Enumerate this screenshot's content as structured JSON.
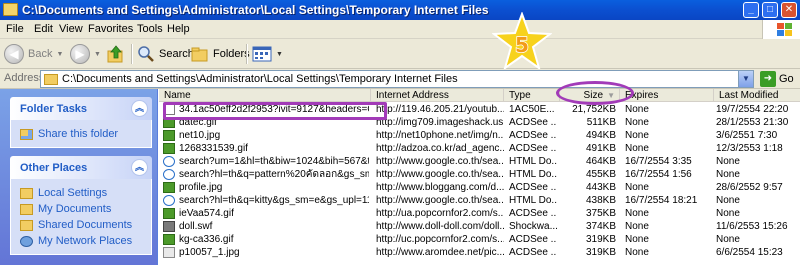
{
  "window": {
    "title": "C:\\Documents and Settings\\Administrator\\Local Settings\\Temporary Internet Files",
    "minimize_glyph": "_",
    "maximize_glyph": "□",
    "close_glyph": "✕"
  },
  "menu": [
    "File",
    "Edit",
    "View",
    "Favorites",
    "Tools",
    "Help"
  ],
  "toolbar": {
    "back_label": "Back",
    "search_label": "Search",
    "folders_label": "Folders"
  },
  "address": {
    "label": "Address",
    "value": "C:\\Documents and Settings\\Administrator\\Local Settings\\Temporary Internet Files",
    "go_label": "Go"
  },
  "task_pane": {
    "folder_tasks": {
      "title": "Folder Tasks",
      "items": [
        "Share this folder"
      ]
    },
    "other_places": {
      "title": "Other Places",
      "items": [
        "Local Settings",
        "My Documents",
        "Shared Documents",
        "My Network Places"
      ]
    }
  },
  "columns": {
    "name": "Name",
    "address": "Internet Address",
    "type": "Type",
    "size": "Size",
    "expires": "Expires",
    "modified": "Last Modified"
  },
  "files": [
    {
      "icon": "generic-file-icon",
      "name": "34.1ac50eff2d2f2953?ivit=9127&headers=Coo...",
      "address": "http://119.46.205.21/youtub...",
      "type": "1AC50E...",
      "size": "21,752KB",
      "expires": "None",
      "modified": "19/7/2554 22:20"
    },
    {
      "icon": "gif-file-icon",
      "name": "datec.gif",
      "address": "http://img709.imageshack.us...",
      "type": "ACDSee ...",
      "size": "511KB",
      "expires": "None",
      "modified": "28/1/2553 21:30"
    },
    {
      "icon": "gif-file-icon",
      "name": "net10.jpg",
      "address": "http://net10phone.net/img/n...",
      "type": "ACDSee ...",
      "size": "494KB",
      "expires": "None",
      "modified": "3/6/2551 7:30"
    },
    {
      "icon": "gif-file-icon",
      "name": "1268331539.gif",
      "address": "http://adzoa.co.kr/ad_agenc...",
      "type": "ACDSee ...",
      "size": "491KB",
      "expires": "None",
      "modified": "12/3/2553 1:18"
    },
    {
      "icon": "html-file-icon",
      "name": "search?um=1&hl=th&biw=1024&bih=567&tbm...",
      "address": "http://www.google.co.th/sea...",
      "type": "HTML Do...",
      "size": "464KB",
      "expires": "16/7/2554 3:35",
      "modified": "None"
    },
    {
      "icon": "html-file-icon",
      "name": "search?hl=th&q=pattern%20คัดลอก&gs_sm=e&g...",
      "address": "http://www.google.co.th/sea...",
      "type": "HTML Do...",
      "size": "455KB",
      "expires": "16/7/2554 1:56",
      "modified": "None"
    },
    {
      "icon": "gif-file-icon",
      "name": "profile.jpg",
      "address": "http://www.bloggang.com/d...",
      "type": "ACDSee ...",
      "size": "443KB",
      "expires": "None",
      "modified": "28/6/2552 9:57"
    },
    {
      "icon": "html-file-icon",
      "name": "search?hl=th&q=kitty&gs_sm=e&gs_upl=1187l...",
      "address": "http://www.google.co.th/sea...",
      "type": "HTML Do...",
      "size": "438KB",
      "expires": "16/7/2554 18:21",
      "modified": "None"
    },
    {
      "icon": "gif-file-icon",
      "name": "ieVaa574.gif",
      "address": "http://ua.popcornfor2.com/s...",
      "type": "ACDSee ...",
      "size": "375KB",
      "expires": "None",
      "modified": "None"
    },
    {
      "icon": "swf-file-icon",
      "name": "doll.swf",
      "address": "http://www.doll-doll.com/doll...",
      "type": "Shockwa...",
      "size": "374KB",
      "expires": "None",
      "modified": "11/6/2553 15:26"
    },
    {
      "icon": "gif-file-icon",
      "name": "kg-ca336.gif",
      "address": "http://uc.popcornfor2.com/s...",
      "type": "ACDSee ...",
      "size": "319KB",
      "expires": "None",
      "modified": "None"
    },
    {
      "icon": "jpg-file-icon",
      "name": "p10057_1.jpg",
      "address": "http://www.aromdee.net/pic...",
      "type": "ACDSee ...",
      "size": "319KB",
      "expires": "None",
      "modified": "6/6/2554 15:23"
    }
  ],
  "overlay": {
    "star_number": "5",
    "colors": {
      "annotation": "#a23bb8",
      "star": "#f7d21c"
    }
  }
}
